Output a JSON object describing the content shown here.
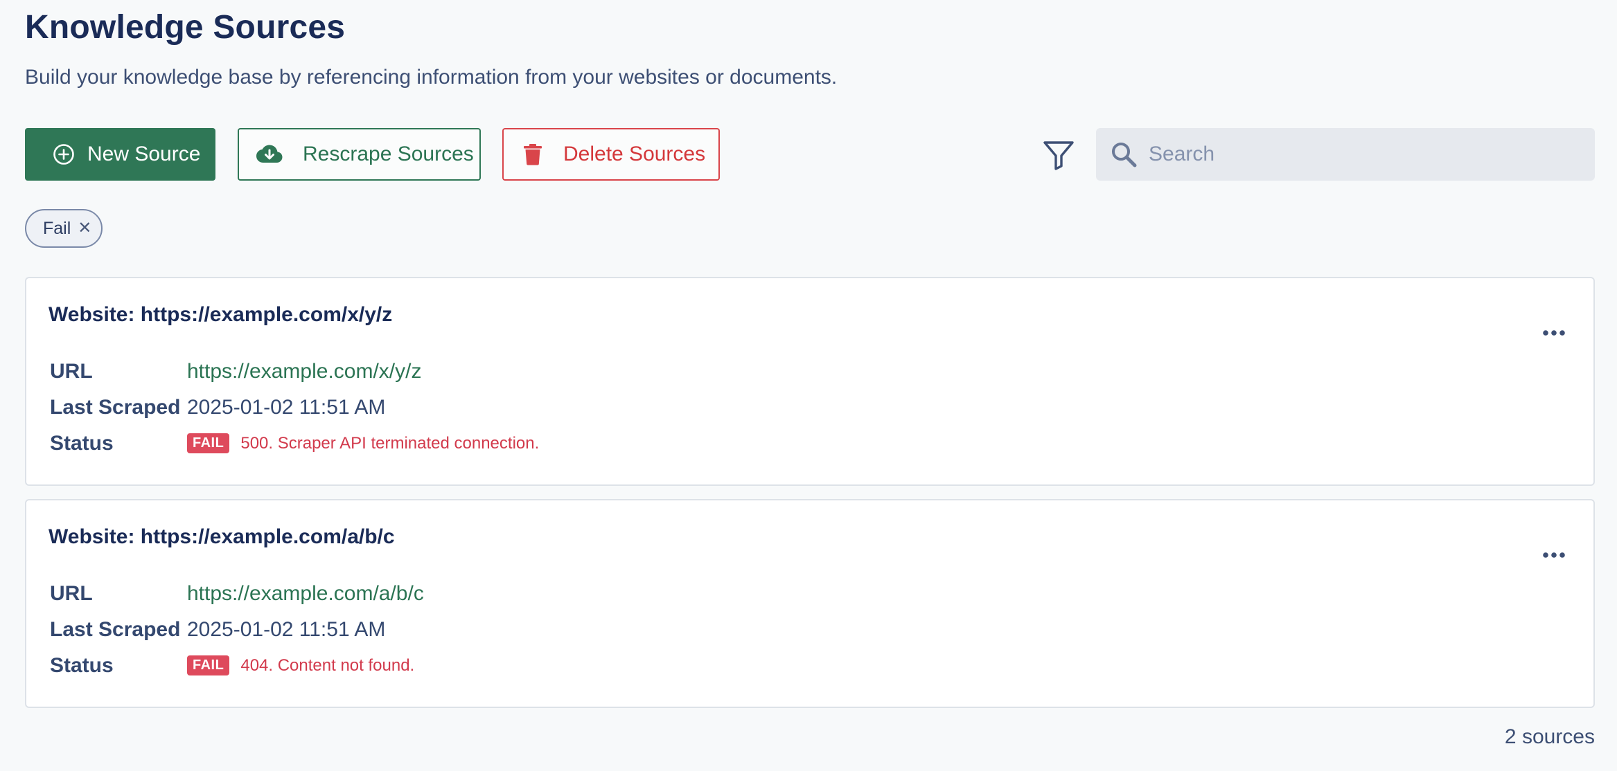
{
  "header": {
    "title": "Knowledge Sources",
    "subtitle": "Build your knowledge base by referencing information from your websites or documents."
  },
  "toolbar": {
    "new_source_label": "New Source",
    "rescrape_label": "Rescrape Sources",
    "delete_label": "Delete Sources",
    "search": {
      "placeholder": "Search",
      "value": ""
    }
  },
  "active_filters": [
    {
      "label": "Fail"
    }
  ],
  "field_labels": {
    "url": "URL",
    "last_scraped": "Last Scraped",
    "status": "Status"
  },
  "sources": [
    {
      "title": "Website: https://example.com/x/y/z",
      "url": "https://example.com/x/y/z",
      "last_scraped": "2025-01-02 11:51 AM",
      "status_badge": "FAIL",
      "status_message": "500. Scraper API terminated connection."
    },
    {
      "title": "Website: https://example.com/a/b/c",
      "url": "https://example.com/a/b/c",
      "last_scraped": "2025-01-02 11:51 AM",
      "status_badge": "FAIL",
      "status_message": "404. Content not found."
    }
  ],
  "footer": {
    "count_label": "2 sources"
  },
  "colors": {
    "primary": "#2f7756",
    "danger": "#d9454a",
    "fail_badge": "#de4a5c",
    "title": "#1a2b57",
    "background": "#f7f9fa"
  },
  "icons": {
    "new_source": "plus-circle-icon",
    "rescrape": "cloud-download-icon",
    "delete": "trash-icon",
    "filter": "filter-icon",
    "search": "search-icon",
    "chip_close": "close-icon",
    "card_menu": "more-horizontal-icon"
  }
}
